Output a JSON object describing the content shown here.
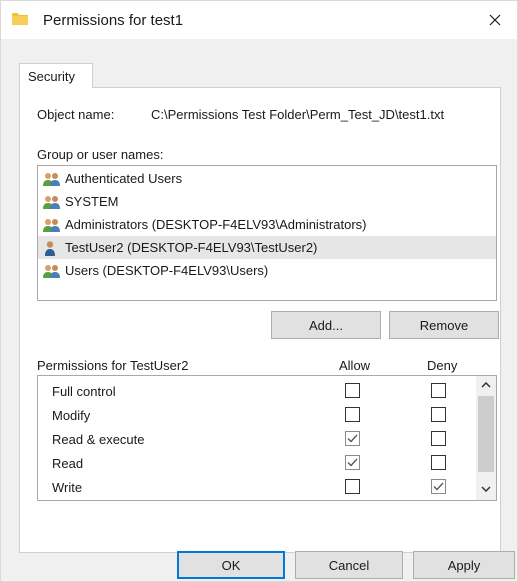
{
  "window": {
    "title": "Permissions for test1",
    "close_symbol": "✕"
  },
  "tabs": [
    {
      "label": "Security"
    }
  ],
  "object": {
    "label": "Object name:",
    "value": "C:\\Permissions Test Folder\\Perm_Test_JD\\test1.txt"
  },
  "groups": {
    "label": "Group or user names:",
    "items": [
      {
        "name": "Authenticated Users",
        "icon": "group-users-icon",
        "selected": false
      },
      {
        "name": "SYSTEM",
        "icon": "group-users-icon",
        "selected": false
      },
      {
        "name": "Administrators (DESKTOP-F4ELV93\\Administrators)",
        "icon": "group-users-icon",
        "selected": false
      },
      {
        "name": "TestUser2 (DESKTOP-F4ELV93\\TestUser2)",
        "icon": "single-user-icon",
        "selected": true
      },
      {
        "name": "Users (DESKTOP-F4ELV93\\Users)",
        "icon": "group-users-icon",
        "selected": false
      }
    ],
    "add_label": "Add...",
    "remove_label": "Remove"
  },
  "permissions": {
    "title": "Permissions for TestUser2",
    "allow_header": "Allow",
    "deny_header": "Deny",
    "rows": [
      {
        "name": "Full control",
        "allow": false,
        "deny": false
      },
      {
        "name": "Modify",
        "allow": false,
        "deny": false
      },
      {
        "name": "Read & execute",
        "allow": true,
        "deny": false
      },
      {
        "name": "Read",
        "allow": true,
        "deny": false
      },
      {
        "name": "Write",
        "allow": false,
        "deny": true
      }
    ]
  },
  "footer": {
    "ok_label": "OK",
    "cancel_label": "Cancel",
    "apply_label": "Apply"
  },
  "colors": {
    "accent": "#0078d7",
    "selection": "#e6e6e6",
    "folder": "#f2c230",
    "group_icon_green": "#5b9e3c",
    "user_icon_blue": "#2e5d8f"
  }
}
